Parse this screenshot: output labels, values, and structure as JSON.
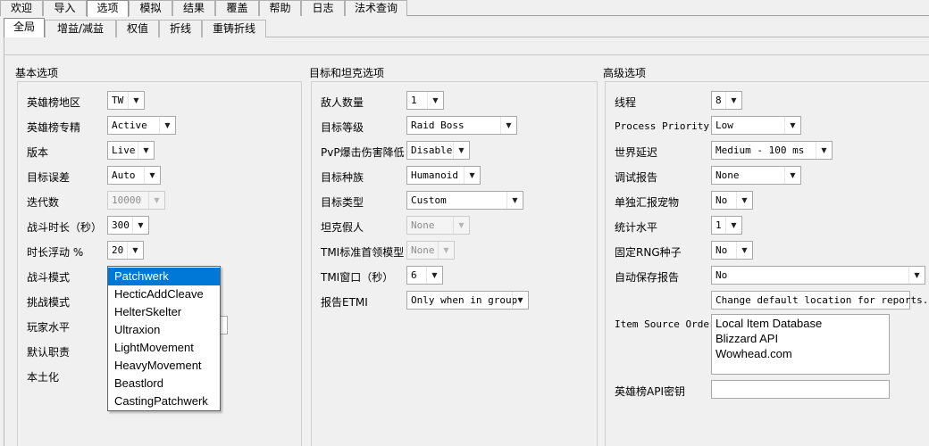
{
  "menu": {
    "tabs": [
      {
        "label": "欢迎"
      },
      {
        "label": "导入"
      },
      {
        "label": "选项",
        "active": true
      },
      {
        "label": "模拟"
      },
      {
        "label": "结果"
      },
      {
        "label": "覆盖"
      },
      {
        "label": "帮助"
      },
      {
        "label": "日志"
      },
      {
        "label": "法术查询"
      }
    ]
  },
  "subtabs": [
    {
      "label": "全局",
      "active": true
    },
    {
      "label": "增益/减益"
    },
    {
      "label": "权值"
    },
    {
      "label": "折线"
    },
    {
      "label": "重铸折线"
    }
  ],
  "basic": {
    "title": "基本选项",
    "rows": [
      {
        "label": "英雄榜地区",
        "value": "TW"
      },
      {
        "label": "英雄榜专精",
        "value": "Active"
      },
      {
        "label": "版本",
        "value": "Live"
      },
      {
        "label": "目标误差",
        "value": "Auto"
      },
      {
        "label": "迭代数",
        "value": "10000",
        "disabled": true
      },
      {
        "label": "战斗时长（秒）",
        "value": "300"
      },
      {
        "label": "时长浮动 %",
        "value": "20"
      },
      {
        "label": "战斗模式",
        "value": "Patchwerk"
      },
      {
        "label": "挑战模式",
        "value": ""
      },
      {
        "label": "玩家水平",
        "value": ""
      },
      {
        "label": "默认职责",
        "value": ""
      },
      {
        "label": "本土化",
        "value": ""
      }
    ]
  },
  "fight_style_dropdown": {
    "options": [
      "Patchwerk",
      "HecticAddCleave",
      "HelterSkelter",
      "Ultraxion",
      "LightMovement",
      "HeavyMovement",
      "Beastlord",
      "CastingPatchwerk"
    ],
    "selected": "Patchwerk"
  },
  "target": {
    "title": "目标和坦克选项",
    "rows": [
      {
        "label": "敌人数量",
        "value": "1"
      },
      {
        "label": "目标等级",
        "value": "Raid Boss"
      },
      {
        "label": "PvP爆击伤害降低",
        "value": "Disable"
      },
      {
        "label": "目标种族",
        "value": "Humanoid"
      },
      {
        "label": "目标类型",
        "value": "Custom"
      },
      {
        "label": "坦克假人",
        "value": "None",
        "disabled": true
      },
      {
        "label": "TMI标准首领模型",
        "value": "None",
        "disabled": true
      },
      {
        "label": "TMI窗口（秒）",
        "value": "6"
      },
      {
        "label": "报告ETMI",
        "value": "Only when in group"
      }
    ]
  },
  "advanced": {
    "title": "高级选项",
    "rows": [
      {
        "label": "线程",
        "value": "8"
      },
      {
        "label": "Process Priority",
        "value": "Low"
      },
      {
        "label": "世界延迟",
        "value": "Medium - 100 ms"
      },
      {
        "label": "调试报告",
        "value": "None"
      },
      {
        "label": "单独汇报宠物",
        "value": "No"
      },
      {
        "label": "统计水平",
        "value": "1"
      },
      {
        "label": "固定RNG种子",
        "value": "No"
      },
      {
        "label": "自动保存报告",
        "value": "No"
      }
    ],
    "save_location_button": "Change default location for reports.",
    "item_source_label": "Item Source Order",
    "item_sources": [
      "Local Item Database",
      "Blizzard API",
      "Wowhead.com"
    ],
    "armory_key_label": "英雄榜API密钥",
    "armory_key_value": ""
  }
}
